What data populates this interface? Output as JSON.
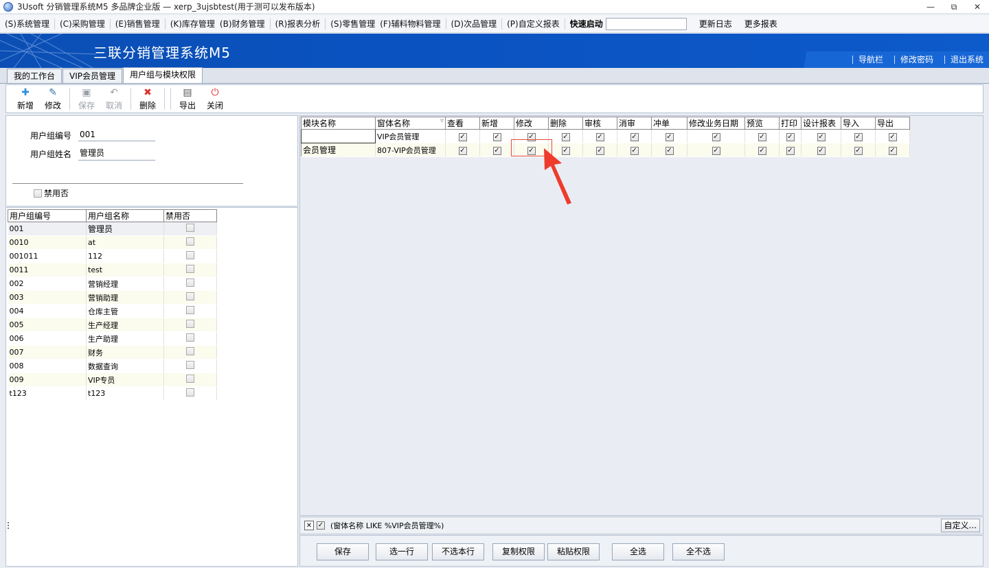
{
  "window": {
    "title": "3Usoft 分销管理系统M5 多品牌企业版 — xerp_3ujsbtest(用于测可以发布版本)",
    "min_glyph": "—",
    "max_glyph": "⧉",
    "close_glyph": "✕"
  },
  "menu": {
    "items": [
      "(S)系统管理",
      "(C)采购管理",
      "(E)销售管理",
      "(K)库存管理",
      "(B)财务管理",
      "(R)报表分析",
      "(S)零售管理",
      "(F)辅料物料管理",
      "(D)次品管理",
      "(P)自定义报表"
    ],
    "quick_launch_label": "快速启动",
    "quick_launch_value": "",
    "changelog": "更新日志",
    "more_reports": "更多报表"
  },
  "banner": {
    "app_name": "三联分销管理系统M5",
    "nav_links": [
      "导航栏",
      "修改密码",
      "退出系统"
    ]
  },
  "tabs": [
    "我的工作台",
    "VIP会员管理",
    "用户组与模块权限"
  ],
  "active_tab_index": 2,
  "toolbar": {
    "buttons": [
      {
        "label": "新增",
        "icon": "plus-icon",
        "glyph": "✚",
        "color": "#2f8fd8",
        "enabled": true
      },
      {
        "label": "修改",
        "icon": "edit-icon",
        "glyph": "✎",
        "color": "#3a6fb0",
        "enabled": true
      },
      {
        "label": "保存",
        "icon": "save-icon",
        "glyph": "▣",
        "color": "#9aa0a8",
        "enabled": false
      },
      {
        "label": "取消",
        "icon": "undo-icon",
        "glyph": "↶",
        "color": "#9aa0a8",
        "enabled": false
      },
      {
        "label": "删除",
        "icon": "delete-icon",
        "glyph": "✖",
        "color": "#d8322a",
        "enabled": true
      },
      {
        "label": "导出",
        "icon": "export-icon",
        "glyph": "▤",
        "color": "#555",
        "enabled": true
      },
      {
        "label": "关闭",
        "icon": "power-icon",
        "glyph": "⏻",
        "color": "#e03030",
        "enabled": true
      }
    ]
  },
  "form": {
    "group_code_label": "用户组编号",
    "group_code_value": "001",
    "group_name_label": "用户组姓名",
    "group_name_value": "管理员",
    "disable_label": "禁用否"
  },
  "group_table": {
    "headers": [
      "用户组编号",
      "用户组名称",
      "禁用否"
    ],
    "rows": [
      [
        "001",
        "管理员"
      ],
      [
        "0010",
        "at"
      ],
      [
        "001011",
        "112"
      ],
      [
        "0011",
        "test"
      ],
      [
        "002",
        "营销经理"
      ],
      [
        "003",
        "营销助理"
      ],
      [
        "004",
        "仓库主管"
      ],
      [
        "005",
        "生产经理"
      ],
      [
        "006",
        "生产助理"
      ],
      [
        "007",
        "财务"
      ],
      [
        "008",
        "数据查询"
      ],
      [
        "009",
        "VIP专员"
      ],
      [
        "t123",
        "t123"
      ]
    ]
  },
  "perm_table": {
    "headers": [
      "模块名称",
      "窗体名称",
      "查看",
      "新增",
      "修改",
      "删除",
      "审核",
      "消审",
      "冲单",
      "修改业务日期",
      "预览",
      "打印",
      "设计报表",
      "导入",
      "导出"
    ],
    "rows": [
      {
        "module": "",
        "form": "VIP会员管理"
      },
      {
        "module": "会员管理",
        "form": "807-VIP会员管理"
      }
    ],
    "check_glyph": "✓",
    "sort_glyph": "▿"
  },
  "filter": {
    "close_glyph": "✕",
    "text": "(窗体名称 LIKE %VIP会员管理%)",
    "custom_button": "自定义..."
  },
  "bottom_buttons": [
    "保存",
    "选一行",
    "不选本行",
    "复制权限",
    "粘贴权限",
    "全选",
    "全不选"
  ],
  "colors": {
    "banner": "#0b4fb4",
    "highlight": "#e5483a"
  }
}
